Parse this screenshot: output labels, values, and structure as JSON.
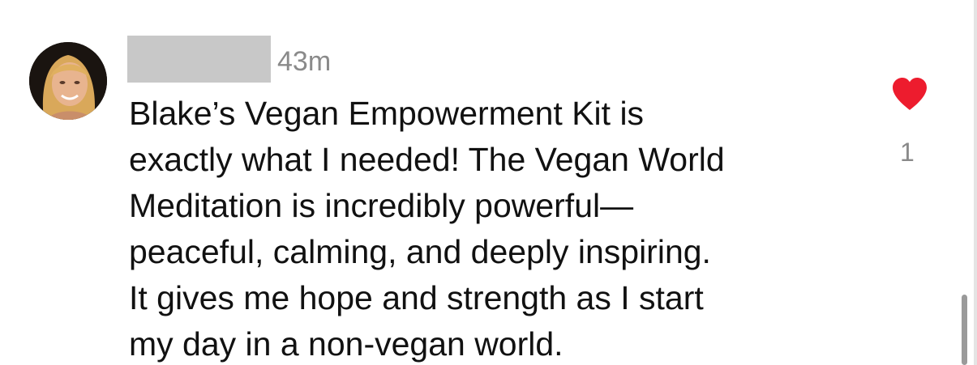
{
  "comment": {
    "avatar_icon": "user-avatar-photo",
    "username": "",
    "timestamp": "43m",
    "text_lines": [
      "Blake’s Vegan Empowerment Kit is",
      "exactly what I needed! The Vegan World",
      "Meditation is incredibly powerful—",
      "peaceful, calming, and deeply inspiring.",
      "It gives me hope and strength as I start",
      "my day in a non-vegan world."
    ],
    "like": {
      "icon": "heart-icon",
      "liked": true,
      "color": "#ed1c2e",
      "count": "1"
    }
  }
}
